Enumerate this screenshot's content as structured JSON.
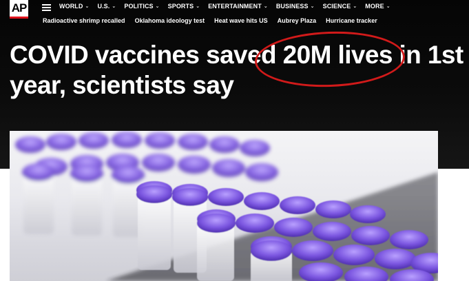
{
  "brand": {
    "logo_text": "AP",
    "accent": "#e0121c"
  },
  "nav": {
    "items": [
      {
        "label": "WORLD"
      },
      {
        "label": "U.S."
      },
      {
        "label": "POLITICS"
      },
      {
        "label": "SPORTS"
      },
      {
        "label": "ENTERTAINMENT"
      },
      {
        "label": "BUSINESS"
      },
      {
        "label": "SCIENCE"
      },
      {
        "label": "MORE"
      }
    ]
  },
  "trending": [
    "Radioactive shrimp recalled",
    "Oklahoma ideology test",
    "Heat wave hits US",
    "Aubrey Plaza",
    "Hurricane tracker"
  ],
  "article": {
    "headline": "COVID vaccines saved 20M lives in 1st year, scientists say",
    "highlight_color": "#d11a1a",
    "photo_icon": "vaccine-vials-photo"
  }
}
